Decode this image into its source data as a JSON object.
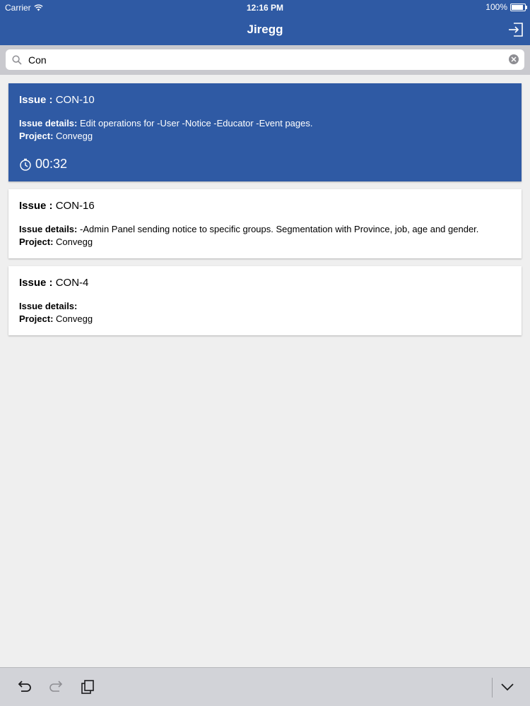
{
  "status": {
    "carrier": "Carrier",
    "time": "12:16 PM",
    "battery": "100%",
    "battery_level": 1.0
  },
  "nav": {
    "title": "Jiregg",
    "logout_icon": "logout-icon"
  },
  "search": {
    "value": "Con",
    "icon": "search-icon",
    "clear_icon": "clear-icon"
  },
  "issues": [
    {
      "label": "Issue :",
      "key": "CON-10",
      "details_label": "Issue details:",
      "details": "Edit operations for -User -Notice -Educator -Event  pages.",
      "project_label": "Project:",
      "project": "Convegg",
      "timer": "00:32",
      "active": true
    },
    {
      "label": "Issue :",
      "key": "CON-16",
      "details_label": "Issue details:",
      "details": "-Admin Panel sending notice to specific groups. Segmentation with Province, job, age and gender.",
      "project_label": "Project:",
      "project": "Convegg",
      "active": false
    },
    {
      "label": "Issue :",
      "key": "CON-4",
      "details_label": "Issue details:",
      "details": "",
      "project_label": "Project:",
      "project": "Convegg",
      "active": false
    }
  ],
  "toolbar": {
    "undo_icon": "undo-icon",
    "redo_icon": "redo-icon",
    "paste_icon": "clipboard-icon",
    "dismiss_icon": "chevron-down-icon"
  },
  "colors": {
    "primary": "#2f5aa4",
    "background": "#efefef",
    "toolbar": "#d2d3d8"
  }
}
